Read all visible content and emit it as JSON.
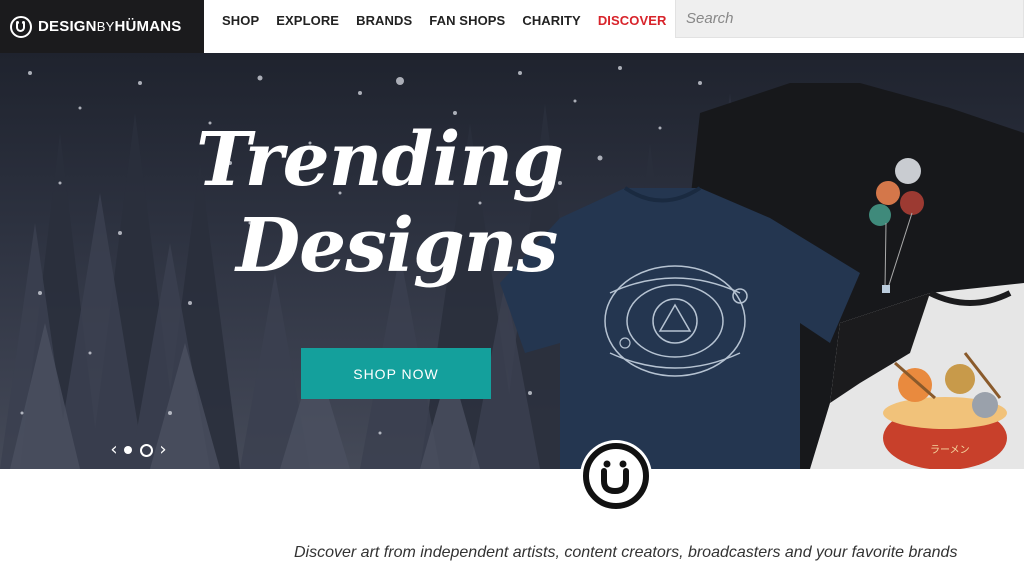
{
  "brand": {
    "name_bold_1": "DESIGN",
    "name_thin": "BY",
    "name_bold_2": "HÜMANS",
    "icon": "smiley-logo-icon"
  },
  "nav": {
    "items": [
      {
        "label": "SHOP"
      },
      {
        "label": "EXPLORE"
      },
      {
        "label": "BRANDS"
      },
      {
        "label": "FAN SHOPS"
      },
      {
        "label": "CHARITY"
      },
      {
        "label": "DISCOVER",
        "color": "#d8232a"
      }
    ]
  },
  "search": {
    "placeholder": "Search",
    "value": ""
  },
  "hero": {
    "headline_line1": "Trending",
    "headline_line2": "Designs",
    "cta_label": "SHOP NOW",
    "cta_color": "#14a09c",
    "carousel": {
      "prev_icon": "chevron-left-icon",
      "next_icon": "chevron-right-icon",
      "prev_glyph": "‹",
      "next_glyph": "›",
      "slides": 2,
      "active_slide": 2
    },
    "products": [
      {
        "kind": "navy t-shirt",
        "graphic": "celtic eye knot"
      },
      {
        "kind": "black long-sleeve shirt",
        "graphic": "planet balloons"
      },
      {
        "kind": "raglan baseball tee",
        "graphic": "cats in ramen bowl",
        "caption": "ラーメン"
      }
    ]
  },
  "badge_icon": "dbh-smiley-badge-icon",
  "tagline": "Discover art from independent artists, content creators, broadcasters and your favorite brands"
}
